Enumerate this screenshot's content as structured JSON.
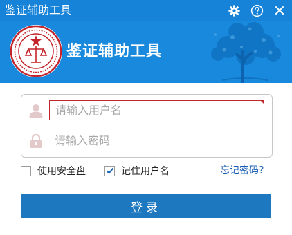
{
  "window": {
    "title": "鉴证辅助工具",
    "accent_color": "#1683d8",
    "controls": {
      "settings_icon": "gear-icon",
      "help_icon": "help-icon",
      "close_icon": "close-icon"
    }
  },
  "banner": {
    "app_title": "鉴证辅助工具",
    "logo": "seal-logo",
    "background_art": "tree-illustration"
  },
  "login_form": {
    "username": {
      "value": "",
      "placeholder": "请输入用户名",
      "icon": "user-icon"
    },
    "password": {
      "value": "",
      "placeholder": "请输入密码",
      "icon": "lock-icon"
    }
  },
  "options": {
    "use_security_disk": {
      "label": "使用安全盘",
      "checked": false
    },
    "remember_username": {
      "label": "记住用户名",
      "checked": true
    },
    "forgot_password": "忘记密码？"
  },
  "login_button": {
    "label": "登录",
    "color": "#1e78bf"
  }
}
